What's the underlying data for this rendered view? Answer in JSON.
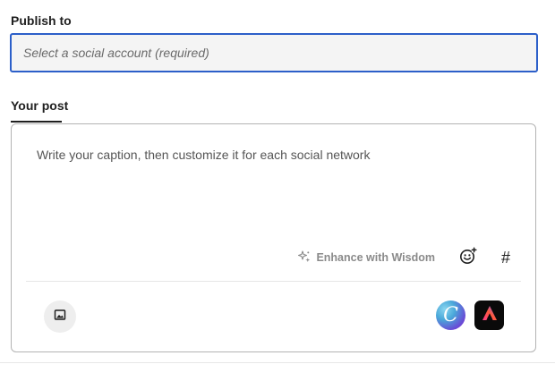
{
  "publish": {
    "label": "Publish to",
    "placeholder": "Select a social account (required)"
  },
  "tabs": [
    {
      "label": "Your post",
      "active": true
    }
  ],
  "post": {
    "caption_placeholder": "Write your caption, then customize it for each social network",
    "enhance_label": "Enhance with Wisdom",
    "hashtag_symbol": "#"
  },
  "icons": {
    "enhance": "sparkle-icon",
    "emoji": "emoji-add-icon",
    "hashtag": "hashtag-icon",
    "media": "image-icon",
    "canva": "canva-icon",
    "express": "adobe-express-icon",
    "canva_letter": "C"
  },
  "colors": {
    "focus_border": "#2c5fc9",
    "text": "#1f1f1f",
    "muted": "#8a8a8a"
  }
}
